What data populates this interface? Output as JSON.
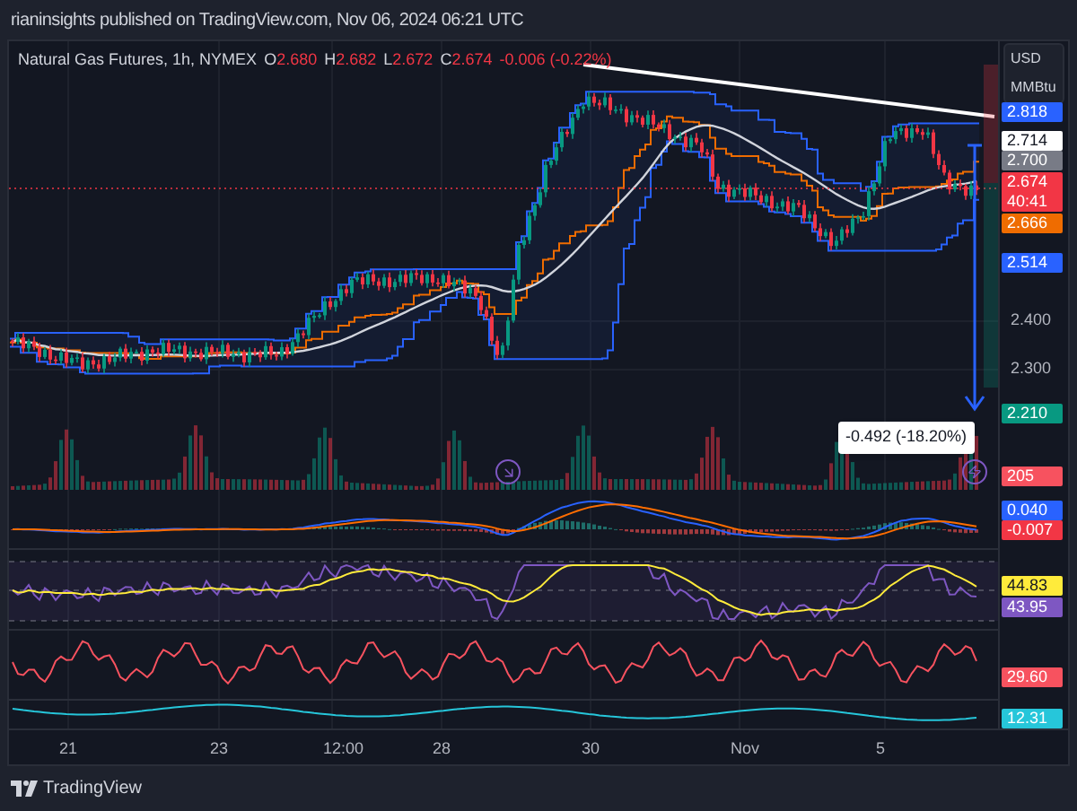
{
  "header": {
    "text": "rianinsights published on TradingView.com, Nov 06, 2024 06:21 UTC"
  },
  "legend": {
    "symbol": "Natural Gas Futures, 1h, NYMEX",
    "ohlc": [
      {
        "label": "O",
        "value": "2.680"
      },
      {
        "label": "H",
        "value": "2.682"
      },
      {
        "label": "L",
        "value": "2.672"
      },
      {
        "label": "C",
        "value": "2.674"
      }
    ],
    "change": "-0.006 (-0.22%)"
  },
  "units": [
    "USD",
    "MMBtu"
  ],
  "price_scale": [
    {
      "text": "2.818",
      "kind": "badge",
      "color": "#2962ff"
    },
    {
      "text": "2.714",
      "kind": "badge",
      "color": "#ffffff"
    },
    {
      "text": "2.700",
      "kind": "badge",
      "color": "#787b86"
    },
    {
      "text": "2.674",
      "sub": "40:41",
      "kind": "badge",
      "color": "#f23645"
    },
    {
      "text": "2.666",
      "kind": "badge",
      "color": "#ef6c00"
    },
    {
      "text": "2.514",
      "kind": "badge",
      "color": "#2962ff"
    },
    {
      "text": "2.400",
      "kind": "tick"
    },
    {
      "text": "2.300",
      "kind": "tick"
    },
    {
      "text": "2.210",
      "kind": "badge",
      "color": "#089981"
    },
    {
      "text": "205",
      "kind": "badge",
      "color": "#f7525f"
    },
    {
      "text": "0.040",
      "kind": "badge",
      "color": "#2962ff"
    },
    {
      "text": "-0.007",
      "kind": "badge",
      "color": "#f23645"
    },
    {
      "text": "44.83",
      "kind": "badge",
      "color": "#ffeb3b"
    },
    {
      "text": "43.95",
      "kind": "badge",
      "color": "#7e57c2"
    },
    {
      "text": "29.60",
      "kind": "badge",
      "color": "#f7525f"
    },
    {
      "text": "12.31",
      "kind": "badge",
      "color": "#26c6da"
    }
  ],
  "measure_label": "-0.492 (-18.20%)",
  "time_axis": [
    "21",
    "23",
    "12:00",
    "28",
    "30",
    "Nov",
    "5"
  ],
  "footer": {
    "brand": "TradingView"
  }
}
